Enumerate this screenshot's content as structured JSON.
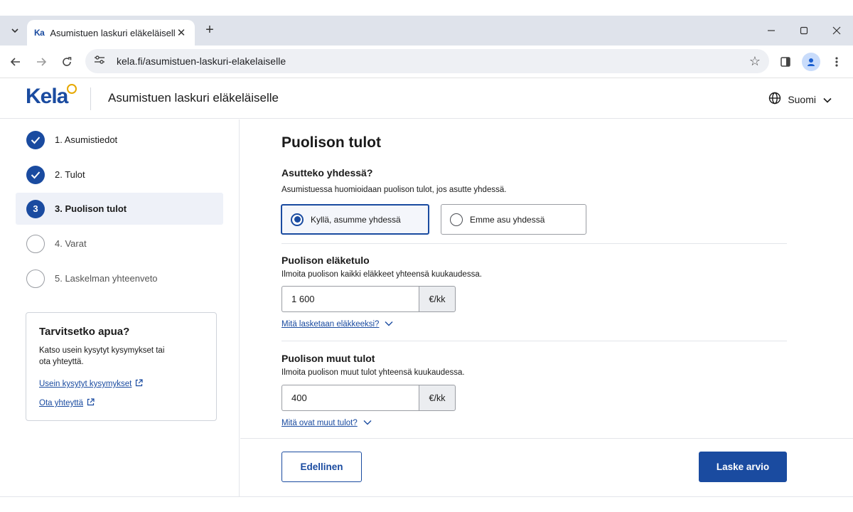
{
  "browser": {
    "tab_title": "Asumistuen laskuri eläkeläiselle",
    "favicon_text": "Ka",
    "url": "kela.fi/asumistuen-laskuri-elakelaiselle"
  },
  "header": {
    "logo": "Kela",
    "title": "Asumistuen laskuri eläkeläiselle",
    "language": "Suomi"
  },
  "steps": [
    {
      "label": "1. Asumistiedot",
      "status": "done"
    },
    {
      "label": "2. Tulot",
      "status": "done"
    },
    {
      "label": "3. Puolison tulot",
      "status": "current",
      "number": "3"
    },
    {
      "label": "4. Varat",
      "status": "todo"
    },
    {
      "label": "5. Laskelman yhteenveto",
      "status": "todo"
    }
  ],
  "help": {
    "title": "Tarvitsetko apua?",
    "text": "Katso usein kysytyt kysymykset tai ota yhteyttä.",
    "links": [
      "Usein kysytyt kysymykset",
      "Ota yhteyttä"
    ]
  },
  "form": {
    "title": "Puolison tulot",
    "living_together": {
      "label": "Asutteko yhdessä?",
      "help": "Asumistuessa huomioidaan puolison tulot, jos asutte yhdessä.",
      "options": [
        "Kyllä, asumme yhdessä",
        "Emme asu yhdessä"
      ],
      "selected": "Kyllä, asumme yhdessä"
    },
    "pension": {
      "label": "Puolison eläketulo",
      "help": "Ilmoita puolison kaikki eläkkeet yhteensä kuukaudessa.",
      "value": "1 600",
      "unit": "€/kk",
      "expand": "Mitä lasketaan eläkkeeksi?"
    },
    "other_income": {
      "label": "Puolison muut tulot",
      "help": "Ilmoita puolison muut tulot yhteensä kuukaudessa.",
      "value": "400",
      "unit": "€/kk",
      "expand": "Mitä ovat muut tulot?"
    }
  },
  "buttons": {
    "previous": "Edellinen",
    "calculate": "Laske arvio"
  },
  "colors": {
    "brand": "#1a4ba0",
    "accent": "#e6a800"
  }
}
